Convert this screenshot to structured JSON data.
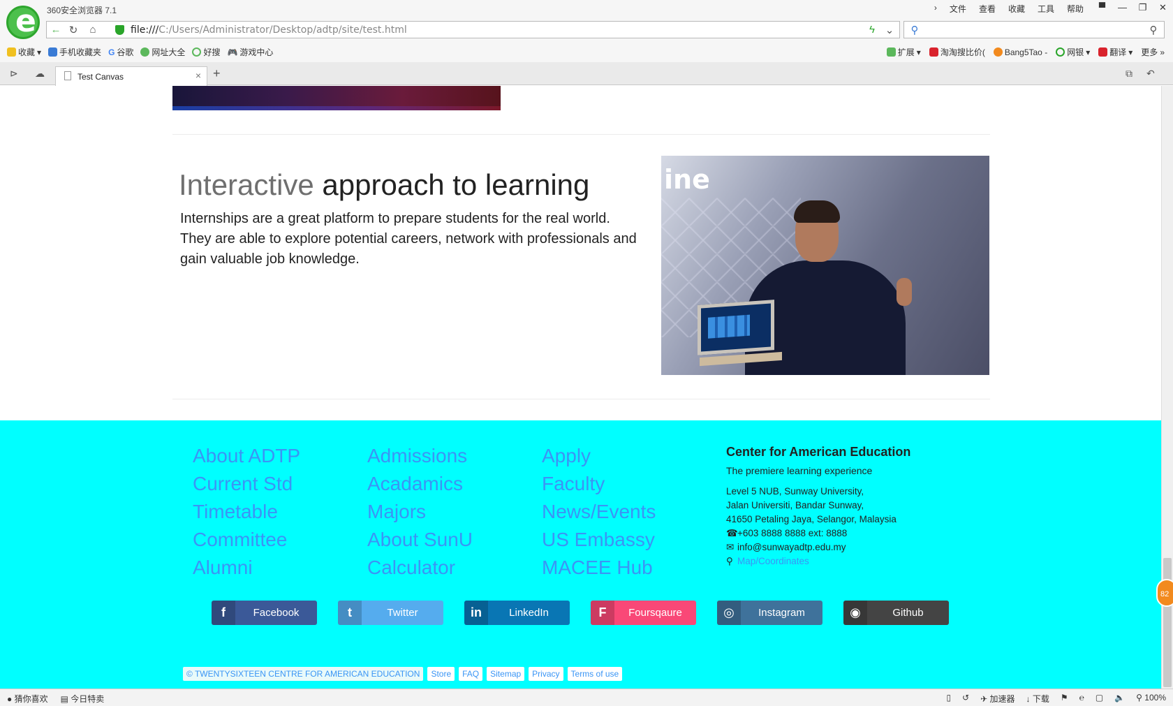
{
  "browser": {
    "app_title": "360安全浏览器 7.1",
    "menu": [
      "文件",
      "查看",
      "收藏",
      "工具",
      "帮助"
    ],
    "url_prefix": "file:///",
    "url_path": "C:/Users/Administrator/Desktop/adtp/site/test.html",
    "bookmarks_left": [
      "收藏",
      "手机收藏夹",
      "谷歌",
      "网址大全",
      "好搜",
      "游戏中心"
    ],
    "bookmarks_right": [
      "扩展",
      "淘淘搜比价(",
      "Bang5Tao -",
      "网银",
      "翻译",
      "更多"
    ],
    "tab_title": "Test Canvas",
    "status_left": [
      "猜你喜欢",
      "今日特卖"
    ],
    "status_right": [
      "加速器",
      "下载",
      "100%"
    ],
    "float_badge": "82"
  },
  "section": {
    "title_muted": "Interactive",
    "title_rest": " approach to learning",
    "text": "Internships are a great platform to prepare students for the real world. They are able to explore potential careers, network with professionals and gain valuable job knowledge.",
    "photo_word": "ine"
  },
  "footer": {
    "col1": [
      "About ADTP",
      "Current Std",
      "Timetable",
      "Committee",
      "Alumni"
    ],
    "col2": [
      "Admissions",
      "Acadamics",
      "Majors",
      "About SunU",
      "Calculator"
    ],
    "col3": [
      "Apply",
      "Faculty",
      "News/Events",
      "US Embassy",
      "MACEE Hub"
    ],
    "contact": {
      "title": "Center for American Education",
      "subtitle": "The premiere learning experience",
      "address1": "Level 5 NUB, Sunway University,",
      "address2": "Jalan Universiti, Bandar Sunway,",
      "address3": "41650 Petaling Jaya, Selangor, Malaysia",
      "phone": "+603 8888 8888 ext: 8888",
      "email": "info@sunwayadtp.edu.my",
      "map": "Map/Coordinates"
    },
    "social": [
      {
        "label": "Facebook",
        "icon": "f",
        "color": "#3b5998"
      },
      {
        "label": "Twitter",
        "icon": "t",
        "color": "#55acee"
      },
      {
        "label": "LinkedIn",
        "icon": "in",
        "color": "#0976b4"
      },
      {
        "label": "Foursqaure",
        "icon": "F",
        "color": "#f94877"
      },
      {
        "label": "Instagram",
        "icon": "◎",
        "color": "#3f729b"
      },
      {
        "label": "Github",
        "icon": "◉",
        "color": "#444444"
      }
    ],
    "copyright": "© TWENTYSIXTEEN CENTRE FOR AMERICAN EDUCATION",
    "links": [
      "Store",
      "FAQ",
      "Sitemap",
      "Privacy",
      "Terms of use"
    ]
  }
}
